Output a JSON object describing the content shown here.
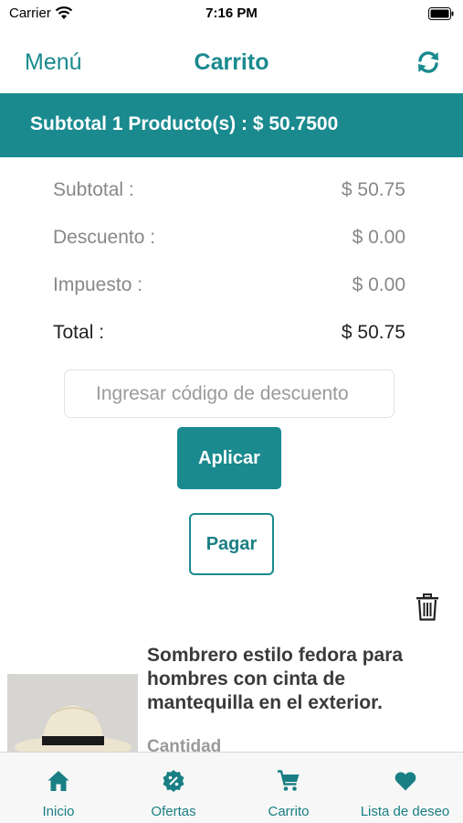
{
  "status_bar": {
    "carrier": "Carrier",
    "time": "7:16 PM"
  },
  "nav": {
    "left_label": "Menú",
    "title": "Carrito",
    "right_icon": "refresh-icon"
  },
  "banner": {
    "text": "Subtotal 1 Producto(s) : $ 50.7500"
  },
  "summary": [
    {
      "label": "Subtotal :",
      "value": "$ 50.75"
    },
    {
      "label": "Descuento :",
      "value": "$ 0.00"
    },
    {
      "label": "Impuesto :",
      "value": "$ 0.00"
    },
    {
      "label": "Total :",
      "value": "$ 50.75"
    }
  ],
  "discount": {
    "placeholder": "Ingresar código de descuento",
    "value": ""
  },
  "buttons": {
    "apply": "Aplicar",
    "pay": "Pagar"
  },
  "product": {
    "name": "Sombrero estilo fedora para hombres con cinta de mantequilla en el exterior.",
    "quantity_label": "Cantidad"
  },
  "tabs": [
    {
      "label": "Inicio",
      "icon": "home-icon"
    },
    {
      "label": "Ofertas",
      "icon": "offers-icon"
    },
    {
      "label": "Carrito",
      "icon": "cart-icon"
    },
    {
      "label": "Lista de deseo",
      "icon": "heart-icon"
    }
  ],
  "colors": {
    "accent": "#1a8a8f",
    "accent_text": "#1a7f84",
    "muted_text": "#888888"
  }
}
